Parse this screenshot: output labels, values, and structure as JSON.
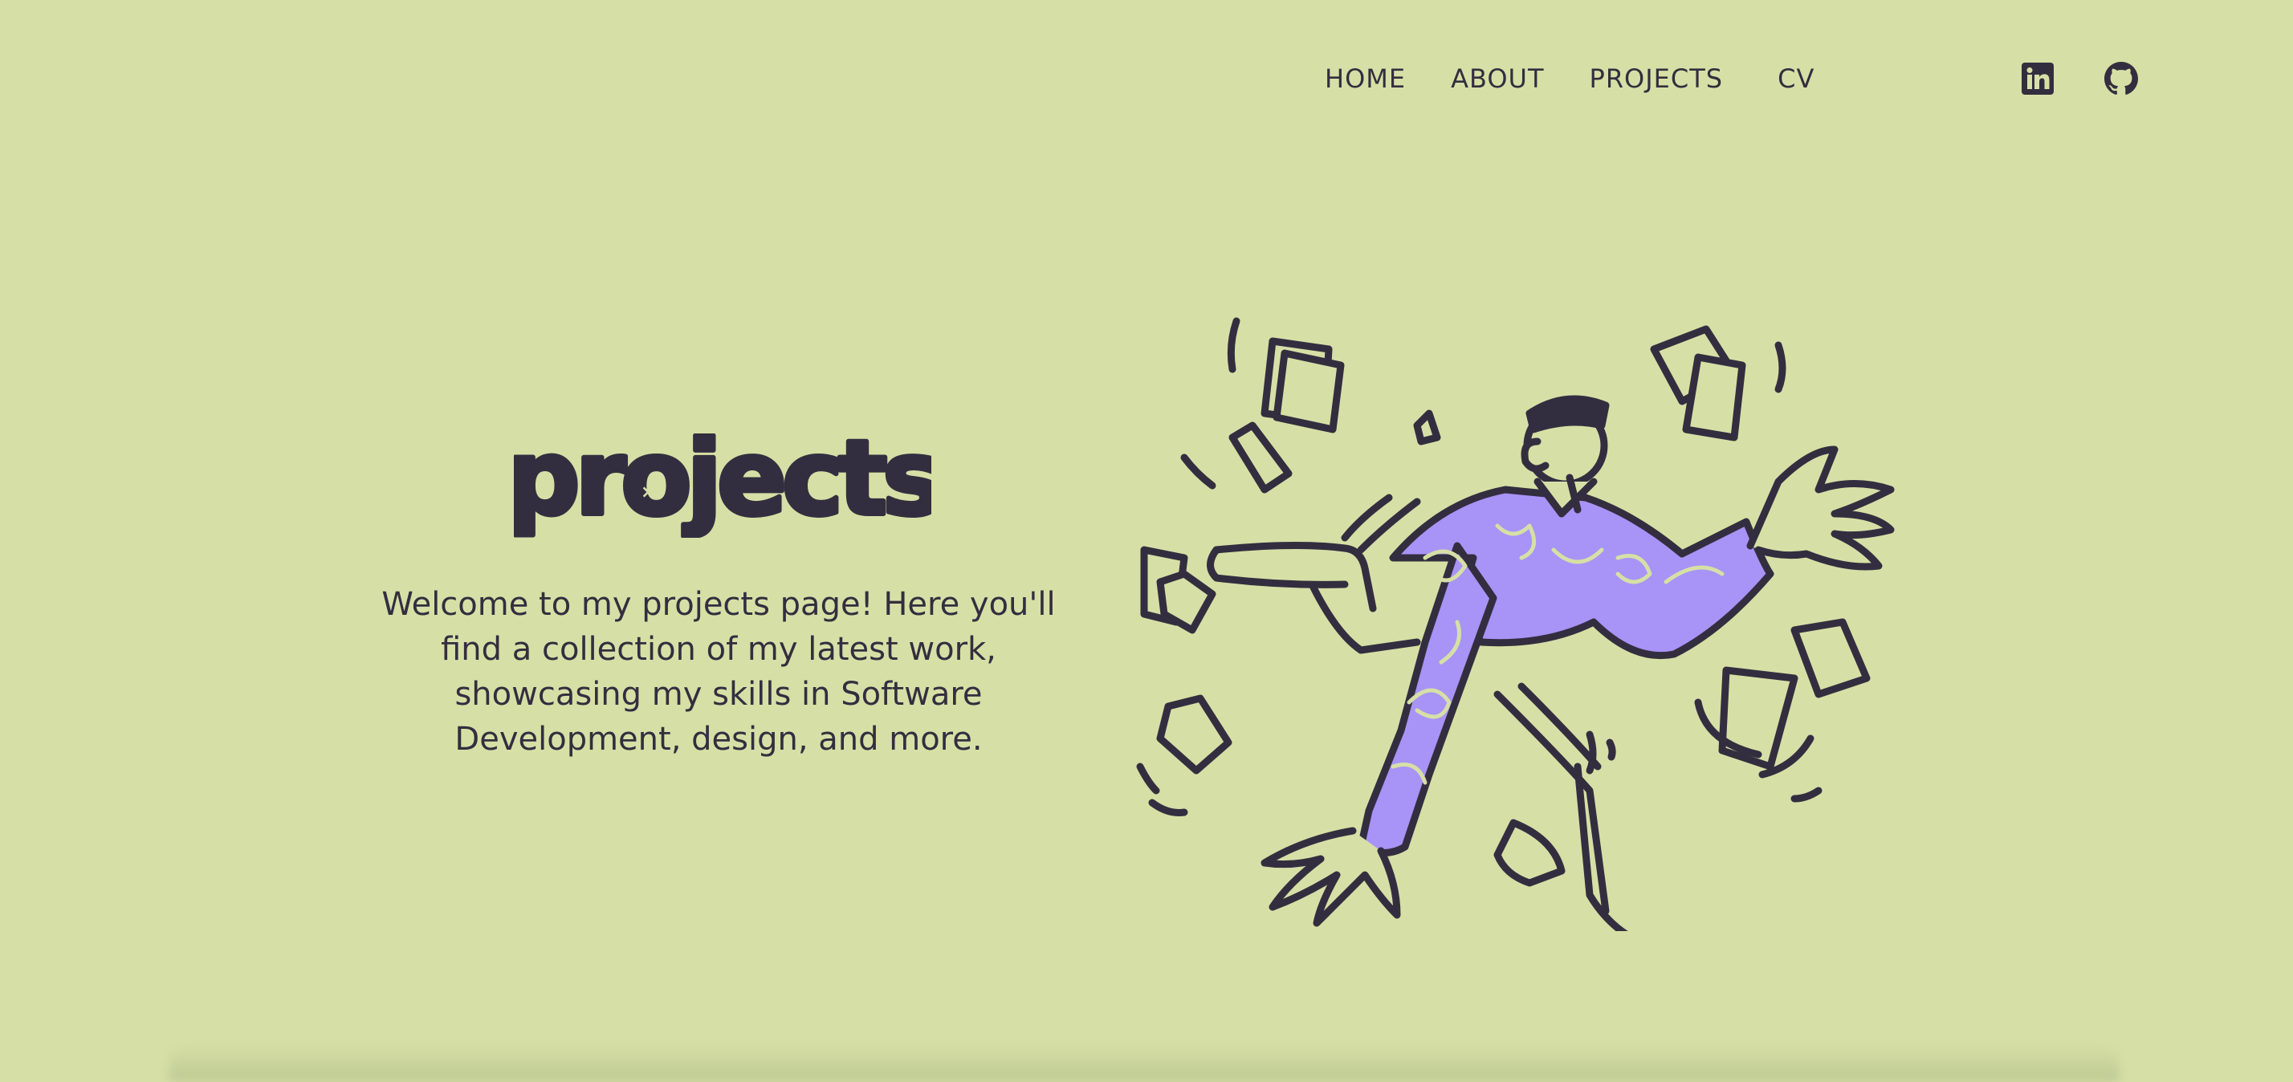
{
  "nav": {
    "links": [
      {
        "label": "HOME"
      },
      {
        "label": "ABOUT"
      },
      {
        "label": "PROJECTS"
      },
      {
        "label": "CV"
      }
    ],
    "social": [
      {
        "icon": "linkedin-icon"
      },
      {
        "icon": "github-icon"
      }
    ]
  },
  "hero": {
    "title": "projects",
    "intro": "Welcome to my projects page! Here you'll find a collection of my latest work, showcasing my skills in Software Development, design, and more."
  },
  "colors": {
    "background": "#d6e0a6",
    "ink": "#332e3f",
    "accent": "#a893f7"
  }
}
